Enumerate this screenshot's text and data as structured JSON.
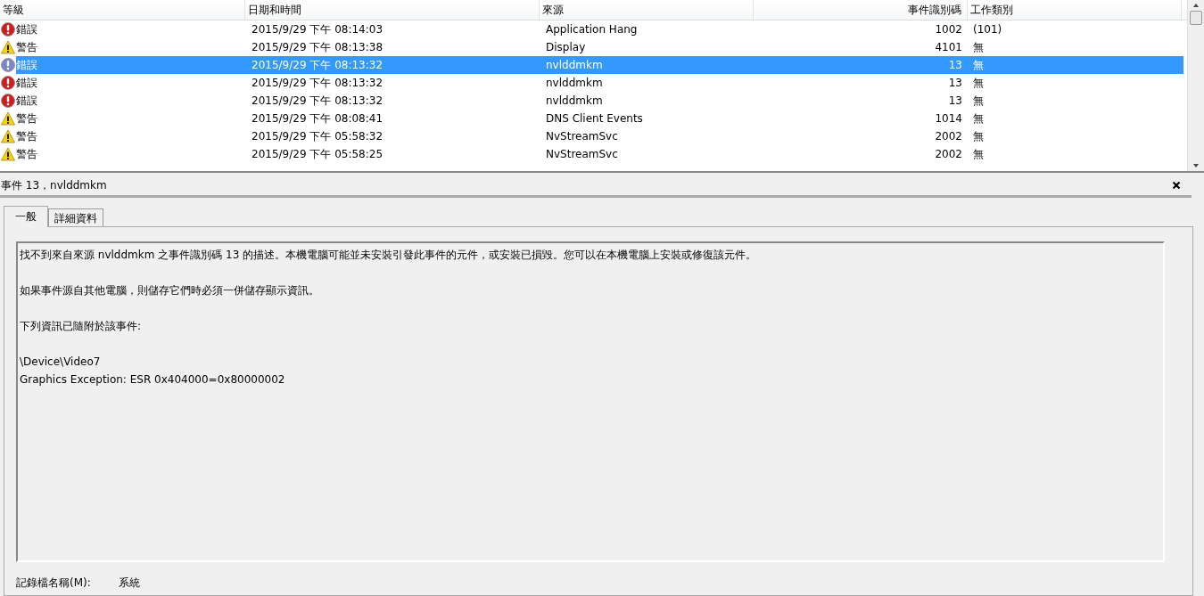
{
  "table": {
    "columns": [
      "等級",
      "日期和時間",
      "來源",
      "事件識別碼",
      "工作類別"
    ],
    "rows": [
      {
        "kind": "error",
        "level": "錯誤",
        "datetime": "2015/9/29 下午 08:14:03",
        "source": "Application Hang",
        "event_id": "1002",
        "category": "(101)",
        "selected": false
      },
      {
        "kind": "warning",
        "level": "警告",
        "datetime": "2015/9/29 下午 08:13:38",
        "source": "Display",
        "event_id": "4101",
        "category": "無",
        "selected": false
      },
      {
        "kind": "error",
        "level": "錯誤",
        "datetime": "2015/9/29 下午 08:13:32",
        "source": "nvlddmkm",
        "event_id": "13",
        "category": "無",
        "selected": true
      },
      {
        "kind": "error",
        "level": "錯誤",
        "datetime": "2015/9/29 下午 08:13:32",
        "source": "nvlddmkm",
        "event_id": "13",
        "category": "無",
        "selected": false
      },
      {
        "kind": "error",
        "level": "錯誤",
        "datetime": "2015/9/29 下午 08:13:32",
        "source": "nvlddmkm",
        "event_id": "13",
        "category": "無",
        "selected": false
      },
      {
        "kind": "warning",
        "level": "警告",
        "datetime": "2015/9/29 下午 08:08:41",
        "source": "DNS Client Events",
        "event_id": "1014",
        "category": "無",
        "selected": false
      },
      {
        "kind": "warning",
        "level": "警告",
        "datetime": "2015/9/29 下午 05:58:32",
        "source": "NvStreamSvc",
        "event_id": "2002",
        "category": "無",
        "selected": false
      },
      {
        "kind": "warning",
        "level": "警告",
        "datetime": "2015/9/29 下午 05:58:25",
        "source": "NvStreamSvc",
        "event_id": "2002",
        "category": "無",
        "selected": false
      }
    ]
  },
  "detail": {
    "title": "事件 13，nvlddmkm",
    "tabs": [
      {
        "label": "一般",
        "selected": true
      },
      {
        "label": "詳細資料",
        "selected": false
      }
    ],
    "paragraphs": [
      [
        "找不到來自來源 nvlddmkm 之事件識別碼 13 的描述。本機電腦可能並未安裝引發此事件的元件，或安裝已損毀。您可以在本機電腦上安裝或修復該元件。"
      ],
      [
        "如果事件源自其他電腦，則儲存它們時必須一併儲存顯示資訊。"
      ],
      [
        "下列資訊已隨附於該事件:"
      ],
      [
        "\\Device\\Video7",
        "Graphics Exception: ESR 0x404000=0x80000002"
      ]
    ],
    "log_name_label": "記錄檔名稱(M):",
    "log_name": "系統"
  }
}
